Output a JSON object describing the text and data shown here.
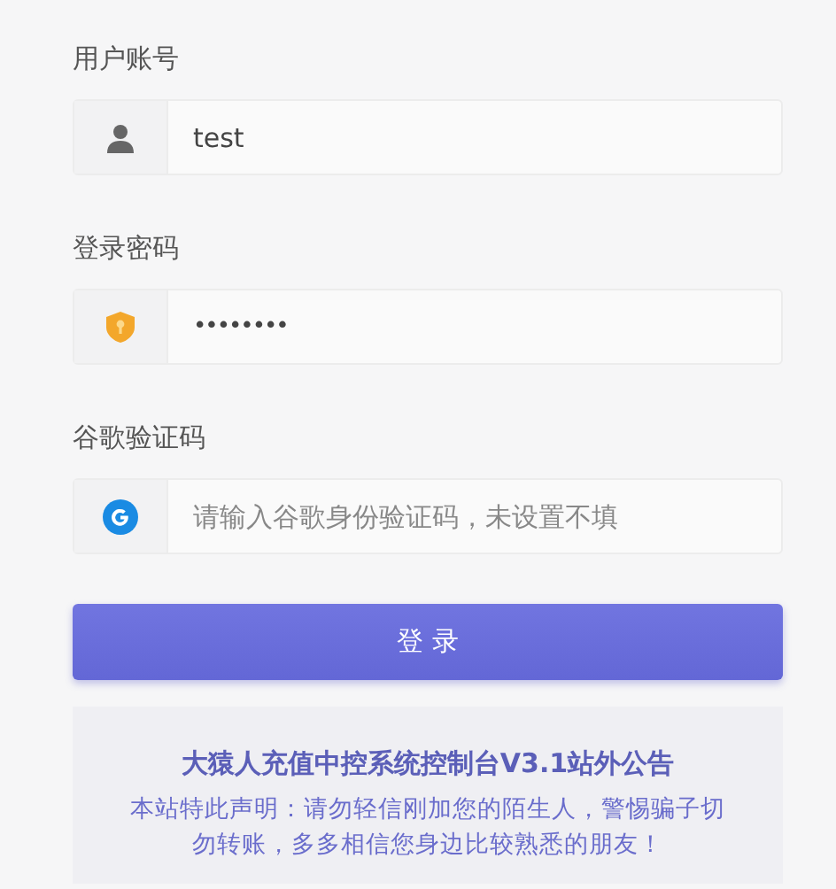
{
  "fields": [
    {
      "kind": "user",
      "label": "用户账号",
      "value": "test"
    },
    {
      "kind": "password",
      "label": "登录密码",
      "value": "••••••••"
    },
    {
      "kind": "google",
      "label": "谷歌验证码",
      "placeholder": "请输入谷歌身份验证码，未设置不填"
    }
  ],
  "login_button": "登 录",
  "notice": {
    "title": "大猿人充值中控系统控制台V3.1站外公告",
    "text": "本站特此声明：请勿轻信刚加您的陌生人，警惕骗子切勿转账，多多相信您身边比较熟悉的朋友！"
  }
}
